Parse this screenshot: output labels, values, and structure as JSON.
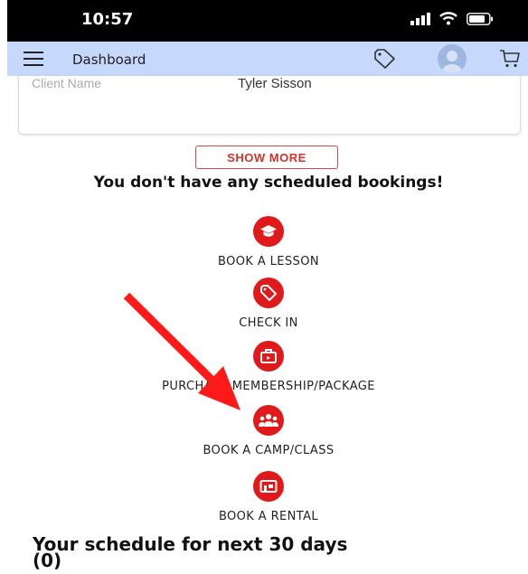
{
  "status_bar": {
    "time": "10:57",
    "icons": [
      "signal-icon",
      "wifi-icon",
      "battery-icon"
    ]
  },
  "app_bar": {
    "title": "Dashboard",
    "icons": [
      "menu-icon",
      "tag-icon",
      "avatar",
      "cart-icon"
    ],
    "background_color": "#c6d8fb"
  },
  "client_card": {
    "label": "Client Name",
    "value": "Tyler Sisson"
  },
  "show_more_label": "SHOW MORE",
  "no_bookings_message": "You don't have any scheduled bookings!",
  "actions": [
    {
      "label": "BOOK A LESSON",
      "icon": "graduation-cap-icon"
    },
    {
      "label": "CHECK IN",
      "icon": "tag-icon"
    },
    {
      "label": "PURCHASE MEMBERSHIP/PACKAGE",
      "icon": "briefcase-icon"
    },
    {
      "label": "BOOK A CAMP/CLASS",
      "icon": "group-icon"
    },
    {
      "label": "BOOK A RENTAL",
      "icon": "storefront-icon"
    }
  ],
  "schedule": {
    "title": "Your schedule for next 30 days",
    "count": "(0)"
  },
  "colors": {
    "accent_red": "#e0191a",
    "annotation_arrow": "#ff1a1a"
  }
}
